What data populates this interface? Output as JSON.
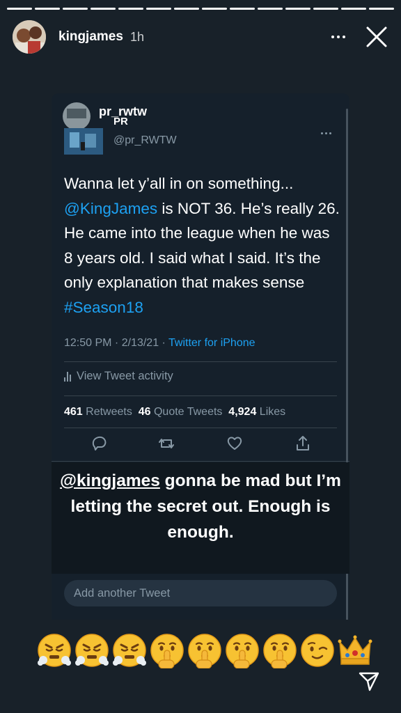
{
  "story": {
    "segments_total": 14,
    "segments_viewed": 14,
    "username": "kingjames",
    "time_ago": "1h"
  },
  "tweet": {
    "display_name": "pr_rwtw",
    "pr_label": "PR",
    "handle": "@pr_RWTW",
    "text_parts": {
      "p1": "Wanna let y’all in on something... ",
      "mention": "@KingJames",
      "p2": " is NOT 36. He’s really 26. He came into the league when he was 8 years old. I said what I said. It’s the only explanation that makes sense ",
      "hashtag": "#Season18"
    },
    "timestamp": "12:50 PM · 2/13/21 · ",
    "source": "Twitter for iPhone",
    "view_activity": "View Tweet activity",
    "retweets_count": "461",
    "retweets_label": " Retweets",
    "quotes_count": "46",
    "quotes_label": " Quote Tweets",
    "likes_count": "4,924",
    "likes_label": " Likes",
    "add_another": "Add another Tweet"
  },
  "caption": {
    "mention": "@kingjames",
    "rest": " gonna be mad but I’m letting the secret out. Enough is enough."
  },
  "emoji_row": [
    "steam-face",
    "steam-face",
    "steam-face",
    "shushing-face",
    "shushing-face",
    "shushing-face",
    "shushing-face",
    "winking-face",
    "crown"
  ],
  "colors": {
    "background": "#182129",
    "tweet_bg": "#15202b",
    "link": "#1da1f2",
    "muted": "#8899a6"
  }
}
